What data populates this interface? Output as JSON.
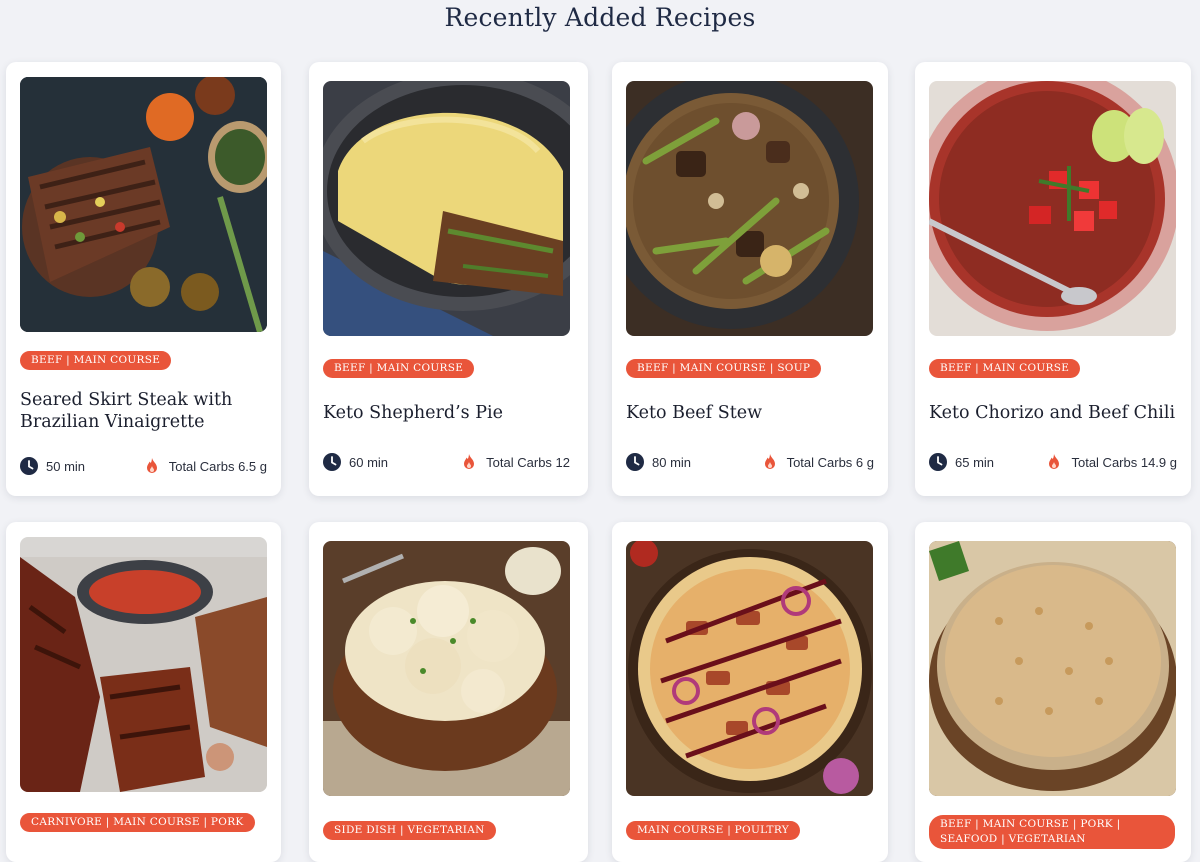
{
  "page_title": "Recently Added Recipes",
  "colors": {
    "accent": "#e9553a",
    "title": "#1f2a44",
    "clock": "#1f2a44"
  },
  "recipes": [
    {
      "title": "Seared Skirt Steak with Brazilian Vinaigrette",
      "tags": "Beef | Main Course",
      "time": "50 min",
      "carbs": "Total Carbs 6.5 g",
      "image": "seared-skirt-steak-photo"
    },
    {
      "title": "Keto Shepherd’s Pie",
      "tags": "Beef | Main Course",
      "time": "60 min",
      "carbs": "Total Carbs 12",
      "image": "shepherds-pie-photo"
    },
    {
      "title": "Keto Beef Stew",
      "tags": "Beef | Main Course | Soup",
      "time": "80 min",
      "carbs": "Total Carbs 6 g",
      "image": "beef-stew-photo"
    },
    {
      "title": "Keto Chorizo and Beef Chili",
      "tags": "Beef | Main Course",
      "time": "65 min",
      "carbs": "Total Carbs 14.9 g",
      "image": "chorizo-beef-chili-photo"
    },
    {
      "title": "",
      "tags": "Carnivore | Main Course | Pork",
      "image": "pork-ribs-photo"
    },
    {
      "title": "",
      "tags": "Side Dish | Vegetarian",
      "image": "cauliflower-mash-photo"
    },
    {
      "title": "",
      "tags": "Main Course | Poultry",
      "image": "bbq-chicken-pizza-photo"
    },
    {
      "title": "",
      "tags": "Beef | Main Course | Pork | Seafood | Vegetarian",
      "image": "pizza-crust-photo"
    }
  ]
}
